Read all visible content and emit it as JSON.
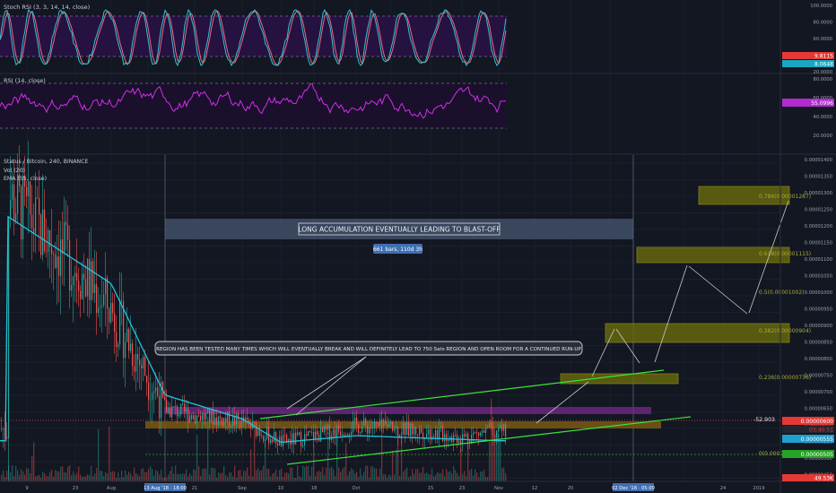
{
  "colors": {
    "background": "#131722",
    "grid": "#1f2330",
    "up_candle": "#26a69a",
    "down_candle": "#ef5350",
    "ema": "#21c4e0",
    "rsi": "#d02ee8",
    "stoch_k": "#2ec4d8",
    "stoch_d": "#e96a80",
    "stoch_band": "#3a1a5a",
    "fib": "#c4c400",
    "trend": "#39e639",
    "annotation": "#d0d0d0",
    "scale_text": "#9aa0ae"
  },
  "stoch_rsi": {
    "label": "Stoch RSI (3, 3, 14, 14, close)",
    "ticks": [
      "100.0000",
      "80.0000",
      "60.0000",
      "40.0000",
      "20.0000"
    ],
    "badge_k": "9.8115",
    "badge_d": "8.0648"
  },
  "rsi": {
    "label": "RSI (14, close)",
    "ticks": [
      "80.0000",
      "60.0000",
      "40.0000",
      "20.0000"
    ],
    "badge": "55.0996"
  },
  "main": {
    "legend": [
      "Status / Bitcoin, 240, BINANCE",
      "Vol (20)",
      "EMA (55, close)"
    ],
    "price_ticks": [
      "0.00001400",
      "0.00001350",
      "0.00001300",
      "0.00001250",
      "0.00001200",
      "0.00001150",
      "0.00001100",
      "0.00001050",
      "0.00001000",
      "0.00000950",
      "0.00000900",
      "0.00000850",
      "0.00000800",
      "0.00000750",
      "0.00000700",
      "0.00000650",
      "0.00000600",
      "0.00000550",
      "0.00000500",
      "0.00000450"
    ],
    "badge_price": "0.00000600",
    "badge_countdown": "03:40:51",
    "badge_ema": "0.00000555",
    "badge_vol": "0.00000505",
    "badge_bottom": "49.53K",
    "change_text": "-52.903",
    "banner_text": "LONG ACCUMULATION EVENTUALLY LEADING TO BLAST-OFF",
    "range_text": "661 bars, 110d 3h",
    "callout_text": "REGION HAS BEEN TESTED MANY TIMES WHICH WILL EVENTUALLY BREAK AND WILL DEFINITELY LEAD TO 750 Sats REGION AND OPEN ROOM FOR A CONTINUED RUN-UP",
    "fib_levels": [
      {
        "label": "0.786(0.00001287)"
      },
      {
        "label": "0.618(0.00001115)"
      },
      {
        "label": "0.5(0.00001002)"
      },
      {
        "label": "0.382(0.00000904)"
      },
      {
        "label": "0.236(0.00000736)"
      },
      {
        "label": "0(0.00000504)"
      }
    ]
  },
  "x_axis": {
    "ticks": [
      "9",
      "23",
      "Aug",
      "13 Aug '18 · 18:00",
      "21",
      "Sep",
      "10",
      "18",
      "Oct",
      "15",
      "23",
      "Nov",
      "12",
      "20",
      "02 Dec '18 · 05:00",
      "24",
      "2019"
    ]
  },
  "chart_data": {
    "type": "candlestick",
    "symbol": "Status / Bitcoin",
    "interval": "240",
    "exchange": "BINANCE",
    "indicators": [
      "Stoch RSI (3, 3, 14, 14, close)",
      "RSI (14, close)",
      "Vol (20)",
      "EMA (55, close)"
    ],
    "price_range": [
      4.5e-06,
      1.4e-05
    ],
    "close_path": [
      [
        "9",
        1.3e-05
      ],
      [
        "16",
        1.17e-05
      ],
      [
        "23",
        1.08e-05
      ],
      [
        "Aug",
        9.5e-06
      ],
      [
        "8",
        8e-06
      ],
      [
        "13 Aug",
        6.6e-06
      ],
      [
        "21",
        6.4e-06
      ],
      [
        "Sep",
        6.2e-06
      ],
      [
        "10",
        5.6e-06
      ],
      [
        "18",
        5.8e-06
      ],
      [
        "Oct",
        6.1e-06
      ],
      [
        "15",
        5.9e-06
      ],
      [
        "23",
        5.75e-06
      ],
      [
        "Nov",
        6e-06
      ]
    ],
    "ema_path": [
      [
        "9",
        1.23e-05
      ],
      [
        "Aug",
        1.03e-05
      ],
      [
        "13 Aug",
        7e-06
      ],
      [
        "Sep",
        6.3e-06
      ],
      [
        "10",
        5.6e-06
      ],
      [
        "Oct",
        5.8e-06
      ],
      [
        "Nov",
        5.65e-06
      ]
    ],
    "projection_path": [
      [
        "Nov",
        6e-06
      ],
      [
        "12",
        7.4e-06
      ],
      [
        "20",
        9e-06
      ],
      [
        "Dec",
        7.5e-06
      ],
      [
        "10",
        1.08e-05
      ],
      [
        "24",
        9.1e-06
      ],
      [
        "2019",
        1.3e-05
      ]
    ],
    "fib_retracement": [
      {
        "ratio": 0.786,
        "price": 1.287e-05
      },
      {
        "ratio": 0.618,
        "price": 1.115e-05
      },
      {
        "ratio": 0.5,
        "price": 1.002e-05
      },
      {
        "ratio": 0.382,
        "price": 9.04e-06
      },
      {
        "ratio": 0.236,
        "price": 7.36e-06
      },
      {
        "ratio": 0,
        "price": 5.04e-06
      }
    ],
    "last_price": 6e-06,
    "ema_last": 5.55e-06,
    "rsi_last": 55.0996,
    "stoch_k_last": 9.8115,
    "stoch_d_last": 8.0648
  }
}
